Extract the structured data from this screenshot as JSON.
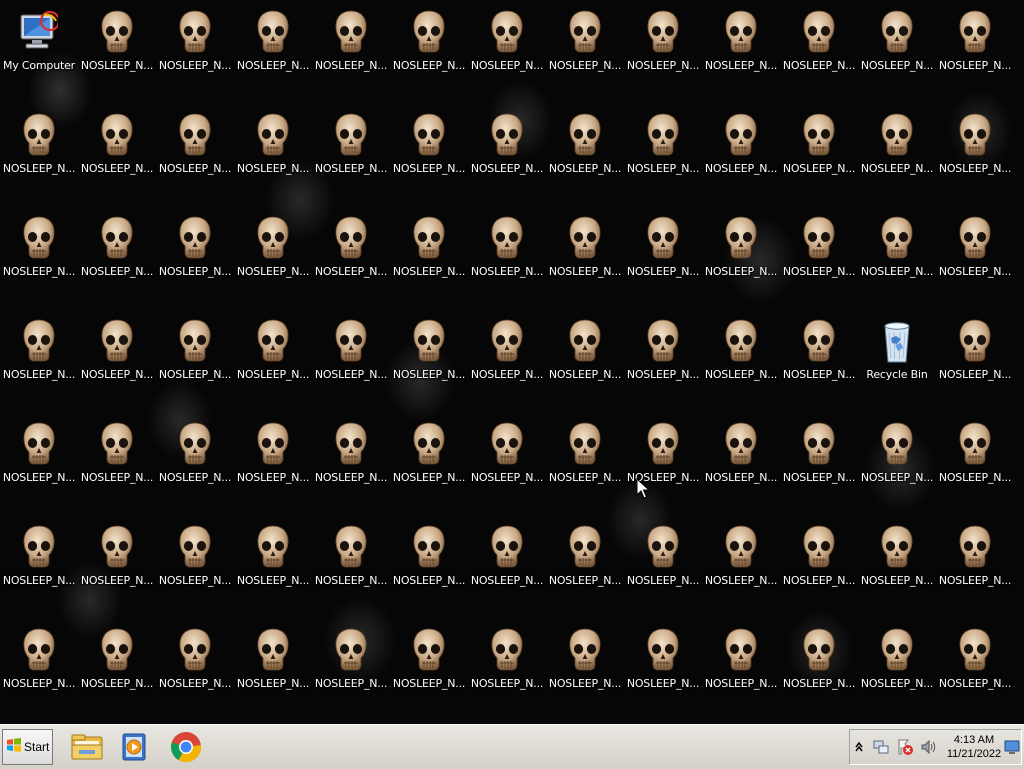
{
  "desktop": {
    "special_icons": {
      "my_computer": "My Computer",
      "recycle_bin": "Recycle Bin"
    },
    "file_icon_label": "NOSLEEP_N...",
    "grid": {
      "columns": 13,
      "rows": 7,
      "special_slots": {
        "my_computer": [
          0,
          0
        ],
        "recycle_bin": [
          11,
          3
        ]
      }
    },
    "icon_names": {
      "file": "skull-icon",
      "my_computer": "computer-icon",
      "recycle_bin": "recycle-bin-icon"
    }
  },
  "taskbar": {
    "start_label": "Start",
    "pinned_apps": [
      {
        "name": "file-explorer",
        "icon": "folder-icon"
      },
      {
        "name": "media-player",
        "icon": "media-player-icon"
      },
      {
        "name": "chrome",
        "icon": "chrome-icon"
      }
    ],
    "tray": {
      "icons": [
        "show-hidden-icons-chevron",
        "network-icon",
        "action-center-icon",
        "volume-icon"
      ],
      "time": "4:13 AM",
      "date": "11/21/2022",
      "show_desktop_icon": "show-desktop-icon"
    }
  }
}
